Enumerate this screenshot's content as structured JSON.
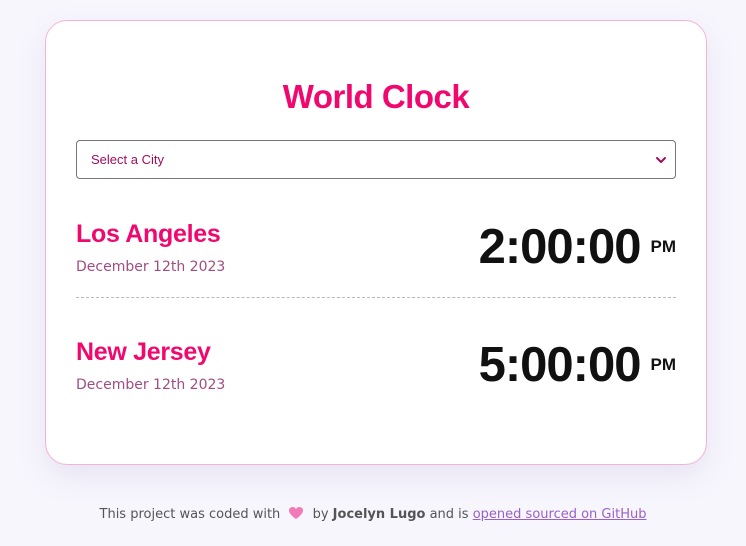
{
  "app": {
    "title": "World Clock"
  },
  "city_select": {
    "placeholder": "Select a City"
  },
  "cities": [
    {
      "name": "Los Angeles",
      "date": "December 12th 2023",
      "time": "2:00:00",
      "ampm": "PM"
    },
    {
      "name": "New Jersey",
      "date": "December 12th 2023",
      "time": "5:00:00",
      "ampm": "PM"
    }
  ],
  "footer": {
    "prefix": "This project was coded with",
    "by": "by",
    "author": "Jocelyn Lugo",
    "middle": "and is",
    "link_text": "opened sourced on GitHub"
  },
  "colors": {
    "accent": "#f0086f",
    "date": "#a24d82",
    "link": "#9a60c7",
    "heart": "#f27ab8"
  },
  "icons": {
    "heart": "heart-icon",
    "chevron": "chevron-down-icon"
  }
}
